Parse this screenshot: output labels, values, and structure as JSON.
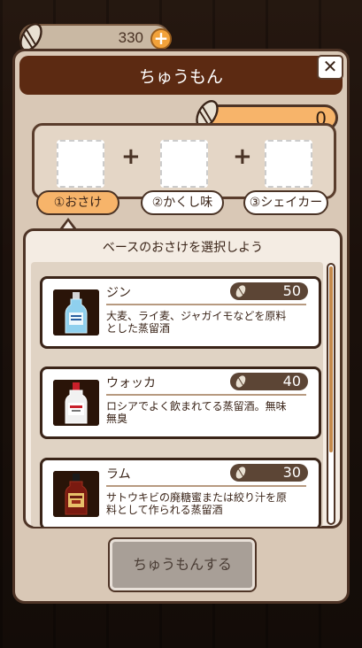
{
  "currency": {
    "amount": "330",
    "plus_label": "+"
  },
  "dialog": {
    "title": "ちゅうもん",
    "close_label": "✕",
    "counter_value": "0",
    "slots": [
      {
        "label": ""
      },
      {
        "label": ""
      },
      {
        "label": ""
      }
    ],
    "plus_signs": [
      "+",
      "+"
    ],
    "steps": [
      {
        "label": "①おさけ",
        "active": true
      },
      {
        "label": "②かくし味",
        "active": false
      },
      {
        "label": "③シェイカー",
        "active": false
      }
    ],
    "list_prompt": "ベースのおさけを選択しよう",
    "items": [
      {
        "name": "ジン",
        "price": "50",
        "desc": "大麦、ライ麦、ジャガイモなどを原料とした蒸留酒",
        "icon": "gin-bottle-icon"
      },
      {
        "name": "ウォッカ",
        "price": "40",
        "desc": "ロシアでよく飲まれてる蒸留酒。無味無臭",
        "icon": "vodka-bottle-icon"
      },
      {
        "name": "ラム",
        "price": "30",
        "desc": "サトウキビの廃糖蜜または絞り汁を原料として作られる蒸留酒",
        "icon": "rum-bottle-icon"
      }
    ],
    "order_button": "ちゅうもんする"
  },
  "colors": {
    "header": "#5c2a12",
    "accent": "#f7b46a",
    "panel": "#d9c8b6",
    "button_disabled": "#a89f97"
  }
}
